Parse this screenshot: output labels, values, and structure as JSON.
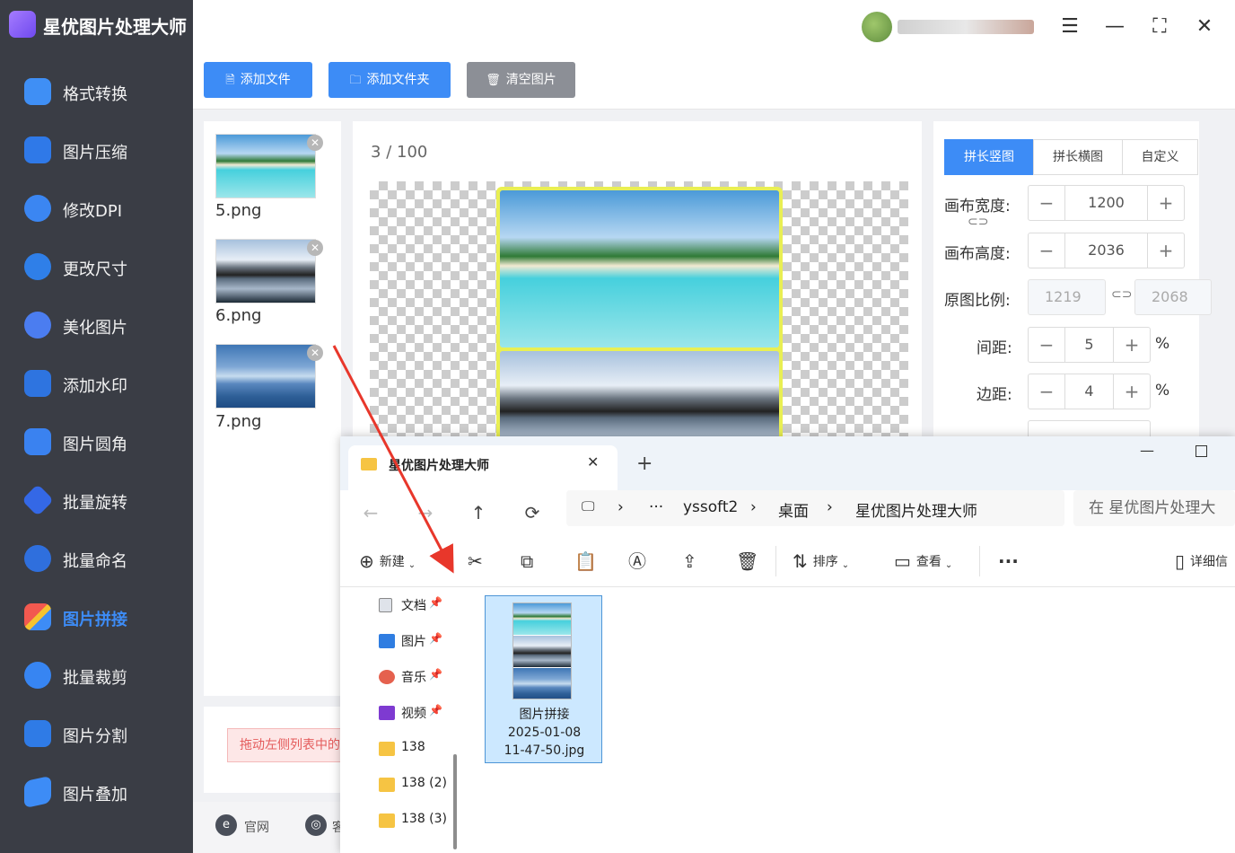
{
  "app": {
    "name": "星优图片处理大师"
  },
  "sidebar": {
    "items": [
      {
        "label": "格式转换",
        "color": "#3f8ff5"
      },
      {
        "label": "图片压缩",
        "color": "#2f79e8"
      },
      {
        "label": "修改DPI",
        "color": "#3b86f2"
      },
      {
        "label": "更改尺寸",
        "color": "#2f7fe8"
      },
      {
        "label": "美化图片",
        "color": "#4b7df0"
      },
      {
        "label": "添加水印",
        "color": "#2e74e0"
      },
      {
        "label": "图片圆角",
        "color": "#3a82f0"
      },
      {
        "label": "批量旋转",
        "color": "#3468e6"
      },
      {
        "label": "批量命名",
        "color": "#2f6fdd"
      },
      {
        "label": "图片拼接",
        "color": "#f2594f",
        "active": true
      },
      {
        "label": "批量裁剪",
        "color": "#3785f2"
      },
      {
        "label": "图片分割",
        "color": "#2f7be6"
      },
      {
        "label": "图片叠加",
        "color": "#3d8cf6"
      }
    ]
  },
  "toolbar": {
    "add_file": "添加文件",
    "add_folder": "添加文件夹",
    "clear": "清空图片"
  },
  "files": [
    {
      "name": "5.png",
      "thumb": "beach"
    },
    {
      "name": "6.png",
      "thumb": "mountain"
    },
    {
      "name": "7.png",
      "thumb": "fog"
    }
  ],
  "preview": {
    "current": "3",
    "total": "100",
    "separator": "/"
  },
  "hint": {
    "text": "拖动左侧列表中的"
  },
  "footer": {
    "website": "官网",
    "service": "客"
  },
  "settings": {
    "tabs": [
      "拼长竖图",
      "拼长横图",
      "自定义"
    ],
    "canvas_width_label": "画布宽度:",
    "canvas_width": "1200",
    "canvas_height_label": "画布高度:",
    "canvas_height": "2036",
    "ratio_label": "原图比例:",
    "ratio_w": "1219",
    "ratio_h": "2068",
    "spacing_label": "间距:",
    "spacing": "5",
    "margin_label": "边距:",
    "margin": "4",
    "percent": "%",
    "minus": "−",
    "plus": "+"
  },
  "explorer": {
    "tab_title": "星优图片处理大师",
    "breadcrumbs": [
      "yssoft2",
      "桌面",
      "星优图片处理大师"
    ],
    "search_placeholder": "在 星优图片处理大",
    "cmd": {
      "new": "新建",
      "sort": "排序",
      "view": "查看",
      "details": "详细信"
    },
    "nav": [
      {
        "label": "文档",
        "pinned": true
      },
      {
        "label": "图片",
        "pinned": true
      },
      {
        "label": "音乐",
        "pinned": true
      },
      {
        "label": "视频",
        "pinned": true
      },
      {
        "label": "138"
      },
      {
        "label": "138 (2)"
      },
      {
        "label": "138 (3)"
      }
    ],
    "file": {
      "line1": "图片拼接",
      "line2": "2025-01-08",
      "line3": "11-47-50.jpg"
    }
  }
}
